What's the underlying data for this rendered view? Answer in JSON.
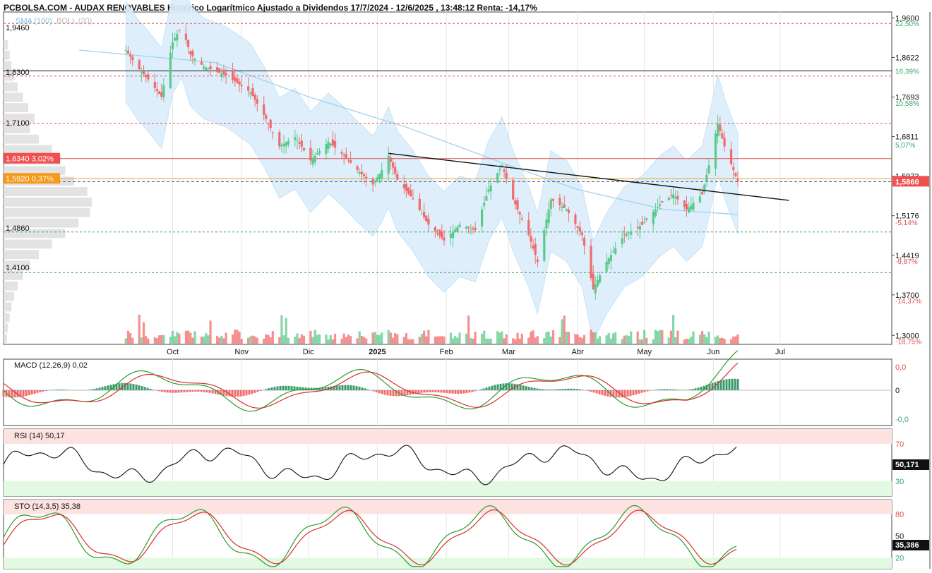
{
  "header": {
    "title": "PCBOLSA.COM - AUDAX RENOVABLES Histórico Logarítmico Ajustado a Dividendos 17/7/2024 - 12/6/2025 , 13:48:12 Renta: -14,17%"
  },
  "legend": {
    "sma": "SMA (100)",
    "boll": "BOLL (20)"
  },
  "colors": {
    "up": "#5cc98a",
    "down": "#f06b6b",
    "sma": "#9fd2f0",
    "band_fill": "#dbeefb",
    "red_line": "#d9534f",
    "green_line": "#3a9a6a",
    "orange": "#f59a1b",
    "price_tag": "#f05050"
  },
  "price_axis": {
    "ticks": [
      "1,9600",
      "1,8622",
      "1,7693",
      "1,6811",
      "1,5973",
      "1,5176",
      "1,4419",
      "1,3700",
      "1,3000"
    ],
    "pct": [
      "22,50%",
      "16,39%",
      "10,58%",
      "5,07%",
      "-5,14%",
      "-9,87%",
      "-14,37%",
      "-18,75%"
    ],
    "current": "1,5860"
  },
  "levels": {
    "l1946": "1,9460",
    "l1830": "1,8300",
    "l1710": "1,7100",
    "l1634": "1,6340",
    "l1634_pct": "3,02%",
    "l1592": "1,5920",
    "l1592_pct": "0,37%",
    "l1486": "1,4860",
    "l1410": "1,4100"
  },
  "months": [
    "Oct",
    "Nov",
    "Dic",
    "2025",
    "Feb",
    "Mar",
    "Abr",
    "May",
    "Jun",
    "Jul"
  ],
  "macd": {
    "label": "MACD (12,26,9)",
    "value": "0,02",
    "ticks": [
      "0,0",
      "0",
      "-0,0"
    ]
  },
  "rsi": {
    "label": "RSI (14)",
    "value": "50,17",
    "ticks": [
      "70",
      "30"
    ],
    "current": "50,171"
  },
  "sto": {
    "label": "STO (14,3,5)",
    "value": "35,38",
    "ticks": [
      "80",
      "50",
      "20"
    ],
    "current": "35,386"
  },
  "chart_data": {
    "type": "candlestick",
    "x_start": "2024-07-17",
    "x_end": "2025-06-12",
    "y_scale": "log",
    "ylim": [
      1.285,
      1.975
    ],
    "close_path": [
      {
        "x": "2024-09-10",
        "close": 1.88
      },
      {
        "x": "2024-09-15",
        "close": 1.84
      },
      {
        "x": "2024-09-20",
        "close": 1.81
      },
      {
        "x": "2024-09-26",
        "close": 1.77
      },
      {
        "x": "2024-10-01",
        "close": 1.9
      },
      {
        "x": "2024-10-05",
        "close": 1.94
      },
      {
        "x": "2024-10-09",
        "close": 1.87
      },
      {
        "x": "2024-10-15",
        "close": 1.84
      },
      {
        "x": "2024-10-25",
        "close": 1.82
      },
      {
        "x": "2024-11-05",
        "close": 1.78
      },
      {
        "x": "2024-11-12",
        "close": 1.72
      },
      {
        "x": "2024-11-18",
        "close": 1.66
      },
      {
        "x": "2024-11-25",
        "close": 1.68
      },
      {
        "x": "2024-12-02",
        "close": 1.63
      },
      {
        "x": "2024-12-10",
        "close": 1.67
      },
      {
        "x": "2024-12-17",
        "close": 1.64
      },
      {
        "x": "2024-12-23",
        "close": 1.61
      },
      {
        "x": "2024-12-30",
        "close": 1.58
      },
      {
        "x": "2025-01-03",
        "close": 1.61
      },
      {
        "x": "2025-01-06",
        "close": 1.64
      },
      {
        "x": "2025-01-10",
        "close": 1.59
      },
      {
        "x": "2025-01-17",
        "close": 1.55
      },
      {
        "x": "2025-01-24",
        "close": 1.5
      },
      {
        "x": "2025-01-31",
        "close": 1.47
      },
      {
        "x": "2025-02-07",
        "close": 1.5
      },
      {
        "x": "2025-02-14",
        "close": 1.49
      },
      {
        "x": "2025-02-20",
        "close": 1.57
      },
      {
        "x": "2025-02-26",
        "close": 1.62
      },
      {
        "x": "2025-03-03",
        "close": 1.55
      },
      {
        "x": "2025-03-10",
        "close": 1.48
      },
      {
        "x": "2025-03-14",
        "close": 1.43
      },
      {
        "x": "2025-03-20",
        "close": 1.55
      },
      {
        "x": "2025-03-27",
        "close": 1.53
      },
      {
        "x": "2025-04-03",
        "close": 1.48
      },
      {
        "x": "2025-04-08",
        "close": 1.38
      },
      {
        "x": "2025-04-14",
        "close": 1.43
      },
      {
        "x": "2025-04-22",
        "close": 1.48
      },
      {
        "x": "2025-04-30",
        "close": 1.5
      },
      {
        "x": "2025-05-08",
        "close": 1.54
      },
      {
        "x": "2025-05-14",
        "close": 1.56
      },
      {
        "x": "2025-05-20",
        "close": 1.53
      },
      {
        "x": "2025-05-27",
        "close": 1.56
      },
      {
        "x": "2025-05-30",
        "close": 1.62
      },
      {
        "x": "2025-06-03",
        "close": 1.71
      },
      {
        "x": "2025-06-06",
        "close": 1.66
      },
      {
        "x": "2025-06-10",
        "close": 1.61
      },
      {
        "x": "2025-06-12",
        "close": 1.586
      }
    ],
    "sma_path": [
      {
        "x": "2024-08-20",
        "y": 1.88
      },
      {
        "x": "2024-10-20",
        "y": 1.85
      },
      {
        "x": "2024-12-01",
        "y": 1.77
      },
      {
        "x": "2025-01-15",
        "y": 1.7
      },
      {
        "x": "2025-03-01",
        "y": 1.62
      },
      {
        "x": "2025-04-01",
        "y": 1.57
      },
      {
        "x": "2025-05-10",
        "y": 1.53
      },
      {
        "x": "2025-06-12",
        "y": 1.52
      }
    ],
    "trendline": [
      {
        "x": "2025-01-06",
        "y": 1.645
      },
      {
        "x": "2025-07-05",
        "y": 1.548
      }
    ],
    "volume_profile_rel": [
      0.05,
      0.07,
      0.09,
      0.12,
      0.16,
      0.22,
      0.28,
      0.35,
      0.3,
      0.4,
      0.55,
      0.65,
      0.7,
      0.8,
      0.95,
      1.0,
      0.98,
      0.85,
      0.7,
      0.55,
      0.4,
      0.3,
      0.22,
      0.16,
      0.12,
      0.09,
      0.07,
      0.05,
      0.04
    ]
  }
}
